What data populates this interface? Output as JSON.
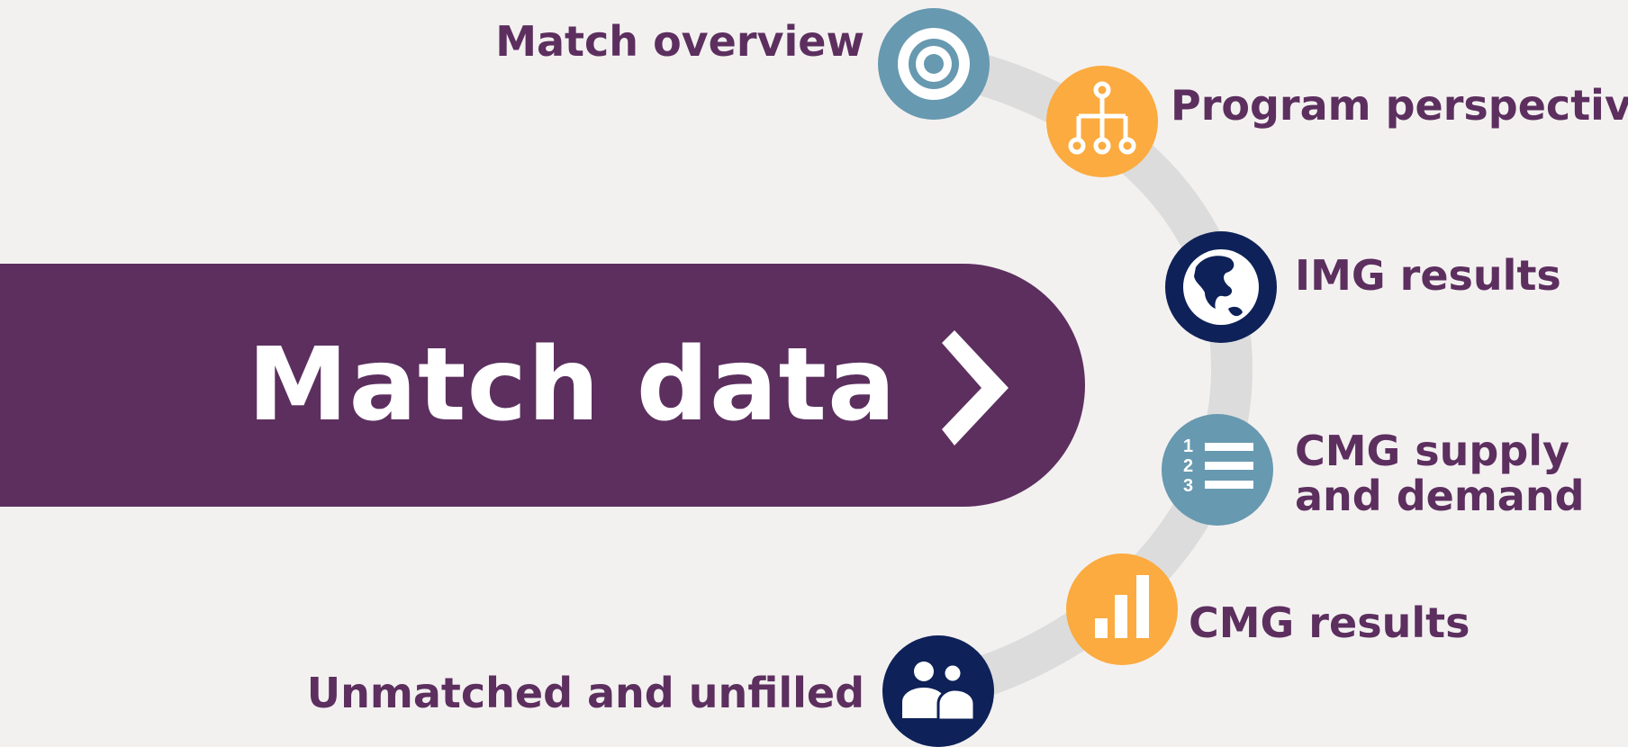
{
  "banner": {
    "title": "Match data"
  },
  "colors": {
    "purple": "#5c2f5f",
    "teal": "#6799b0",
    "orange": "#fbab3f",
    "navy": "#0e2158",
    "arc": "#dcdcdc",
    "background": "#f3f1f0"
  },
  "steps": [
    {
      "label": "Match overview",
      "icon": "target-icon",
      "color": "teal"
    },
    {
      "label": "Program perspective",
      "icon": "hierarchy-icon",
      "color": "orange"
    },
    {
      "label": "IMG results",
      "icon": "globe-icon",
      "color": "navy"
    },
    {
      "label": "CMG supply and demand",
      "icon": "numbered-list-icon",
      "color": "teal"
    },
    {
      "label": "CMG results",
      "icon": "bar-chart-icon",
      "color": "orange"
    },
    {
      "label": "Unmatched and unfilled",
      "icon": "people-icon",
      "color": "navy"
    }
  ]
}
